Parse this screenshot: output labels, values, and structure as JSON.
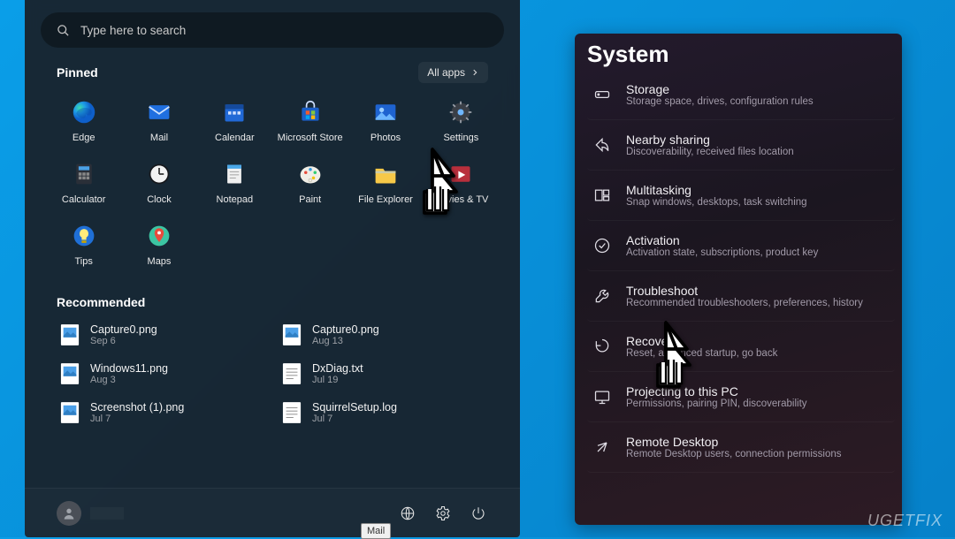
{
  "search": {
    "placeholder": "Type here to search"
  },
  "sections": {
    "pinned": "Pinned",
    "recommended": "Recommended",
    "allapps": "All apps"
  },
  "pinned": [
    {
      "name": "Edge",
      "icon": "edge"
    },
    {
      "name": "Mail",
      "icon": "mail"
    },
    {
      "name": "Calendar",
      "icon": "calendar"
    },
    {
      "name": "Microsoft Store",
      "icon": "store"
    },
    {
      "name": "Photos",
      "icon": "photos"
    },
    {
      "name": "Settings",
      "icon": "settings"
    },
    {
      "name": "Calculator",
      "icon": "calculator"
    },
    {
      "name": "Clock",
      "icon": "clock"
    },
    {
      "name": "Notepad",
      "icon": "notepad"
    },
    {
      "name": "Paint",
      "icon": "paint"
    },
    {
      "name": "File Explorer",
      "icon": "explorer"
    },
    {
      "name": "Movies & TV",
      "icon": "movies"
    },
    {
      "name": "Tips",
      "icon": "tips"
    },
    {
      "name": "Maps",
      "icon": "maps"
    }
  ],
  "recommended": [
    {
      "name": "Capture0.png",
      "date": "Sep 6",
      "type": "image"
    },
    {
      "name": "Capture0.png",
      "date": "Aug 13",
      "type": "image"
    },
    {
      "name": "Windows11.png",
      "date": "Aug 3",
      "type": "image"
    },
    {
      "name": "DxDiag.txt",
      "date": "Jul 19",
      "type": "text"
    },
    {
      "name": "Screenshot (1).png",
      "date": "Jul 7",
      "type": "image"
    },
    {
      "name": "SquirrelSetup.log",
      "date": "Jul 7",
      "type": "text"
    }
  ],
  "tooltip": "Mail",
  "syspanel": {
    "title": "System",
    "items": [
      {
        "title": "Storage",
        "desc": "Storage space, drives, configuration rules",
        "icon": "storage"
      },
      {
        "title": "Nearby sharing",
        "desc": "Discoverability, received files location",
        "icon": "share"
      },
      {
        "title": "Multitasking",
        "desc": "Snap windows, desktops, task switching",
        "icon": "multitask"
      },
      {
        "title": "Activation",
        "desc": "Activation state, subscriptions, product key",
        "icon": "activation"
      },
      {
        "title": "Troubleshoot",
        "desc": "Recommended troubleshooters, preferences, history",
        "icon": "troubleshoot"
      },
      {
        "title": "Recovery",
        "desc": "Reset, advanced startup, go back",
        "icon": "recovery"
      },
      {
        "title": "Projecting to this PC",
        "desc": "Permissions, pairing PIN, discoverability",
        "icon": "project"
      },
      {
        "title": "Remote Desktop",
        "desc": "Remote Desktop users, connection permissions",
        "icon": "remote"
      }
    ]
  },
  "watermark": "UGETFIX"
}
